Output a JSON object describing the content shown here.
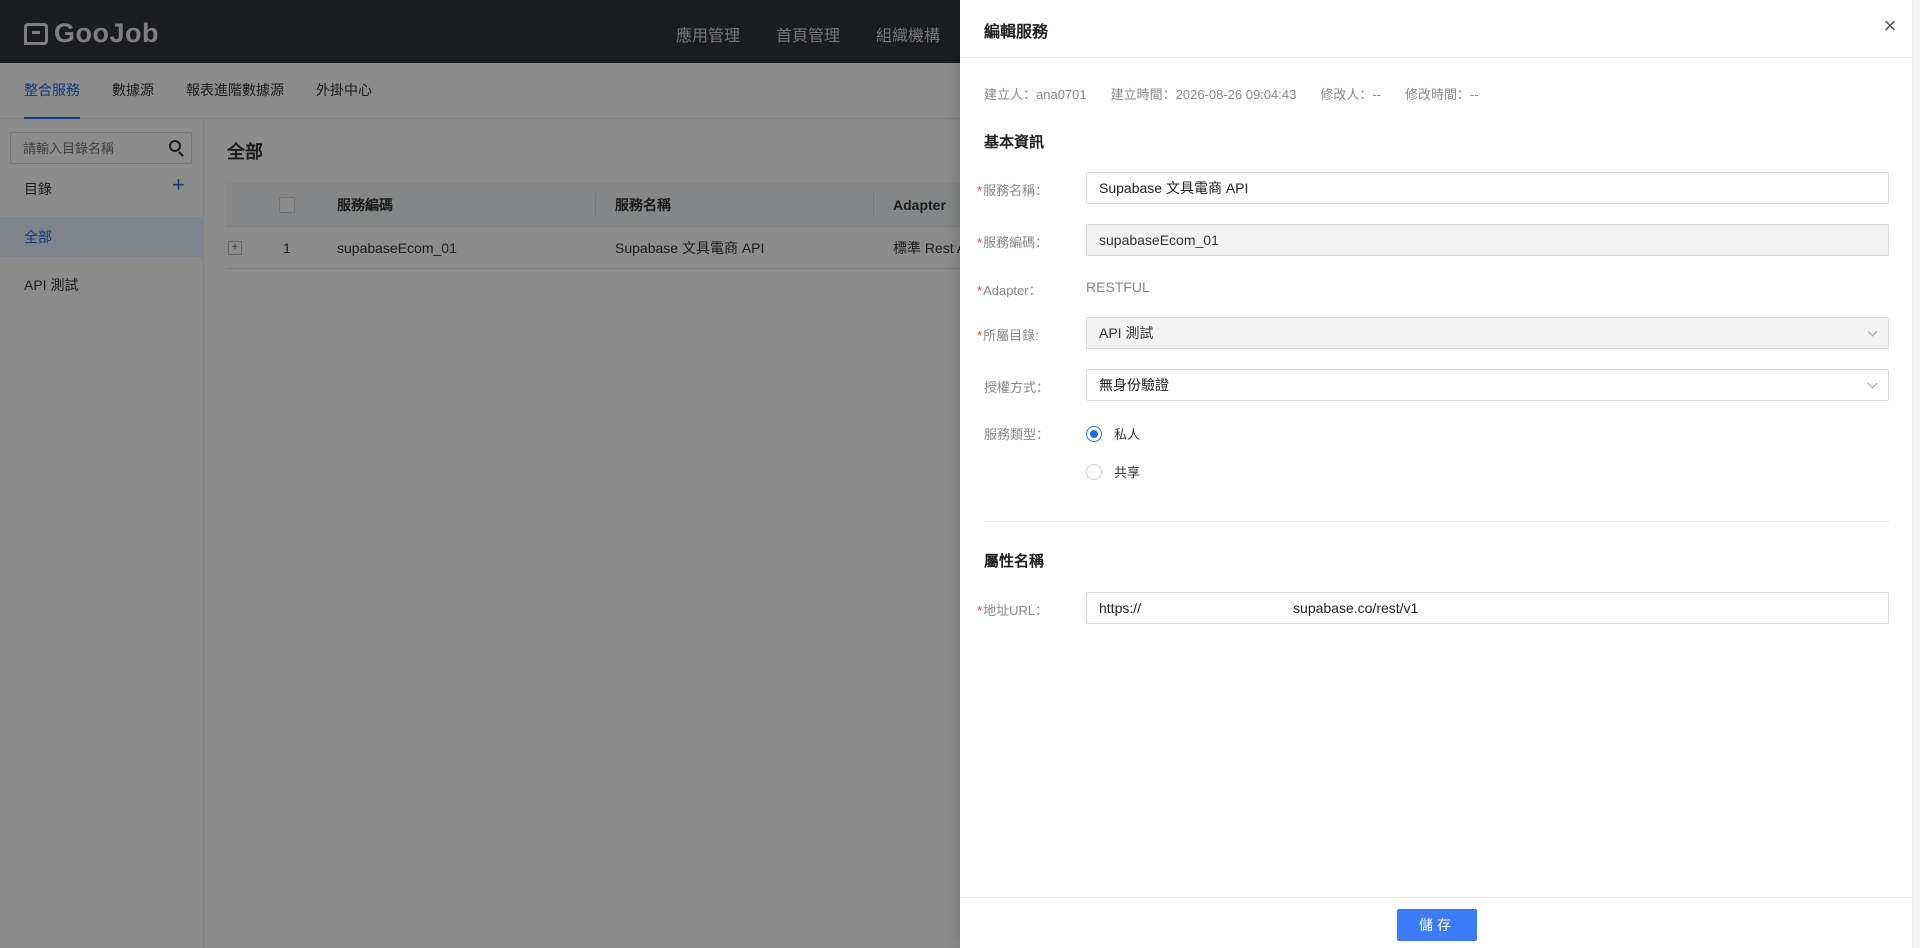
{
  "app": {
    "logo_text": "GooJob"
  },
  "top_menu": [
    "應用管理",
    "首頁管理",
    "組織機構"
  ],
  "subnav": {
    "tabs": [
      "整合服務",
      "數據源",
      "報表進階數據源",
      "外掛中心"
    ]
  },
  "sidebar": {
    "search_placeholder": "請輸入目錄名稱",
    "dir_label": "目錄",
    "add_symbol": "+",
    "items": [
      "全部",
      "API 測試"
    ]
  },
  "content": {
    "title": "全部",
    "columns": [
      "服務編碼",
      "服務名稱",
      "Adapter"
    ],
    "rows": [
      {
        "index": "1",
        "code": "supabaseEcom_01",
        "name": "Supabase 文具電商 API",
        "adapter": "標準 Rest A"
      }
    ]
  },
  "drawer": {
    "title": "編輯服務",
    "close_symbol": "×",
    "meta": {
      "creator": "建立人：ana0701",
      "created_at": "建立時間：2026-08-26 09:04:43",
      "modifier": "修改人：--",
      "modified_at": "修改時間：--"
    },
    "basic_section": "基本資訊",
    "fields": {
      "service_name_label": "服務名稱：",
      "service_name_value": "Supabase 文具電商 API",
      "service_code_label": "服務編碼：",
      "service_code_value": "supabaseEcom_01",
      "adapter_label": "Adapter：",
      "adapter_value": "RESTFUL",
      "directory_label": "所屬目錄:",
      "directory_value": "API 測試",
      "auth_label": "授權方式：",
      "auth_value": "無身份驗證",
      "service_type_label": "服務類型：",
      "service_type_options": [
        "私人",
        "共享"
      ],
      "service_type_selected": "私人"
    },
    "attr_section": "屬性名稱",
    "url_label": "地址URL：",
    "url_prefix": "https://",
    "url_suffix": "supabase.co/rest/v1",
    "save_label": "儲存"
  },
  "colors": {
    "accent": "#1e6fd9",
    "primary_button": "#3b7bf6",
    "required": "#e53935",
    "topbar": "#30333a"
  }
}
